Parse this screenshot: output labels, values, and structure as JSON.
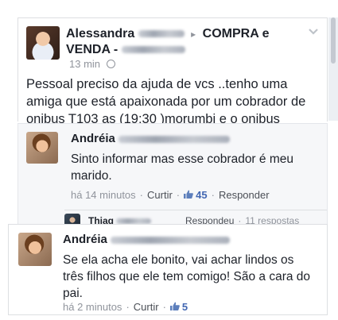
{
  "post": {
    "author_first": "Alessandra",
    "arrow": "▸",
    "group": "COMPRA e VENDA -",
    "time": "13 min",
    "text": "Pessoal preciso da ajuda de vcs ..tenho uma amiga que está apaixonada por um cobrador de onibus T103 as (19:30 )morumbi  e o onibus"
  },
  "comment1": {
    "author_first": "Andréia",
    "text": "Sinto informar mas esse cobrador é meu marido.",
    "time": "há 14 minutos",
    "curtir": "Curtir",
    "likes": "45",
    "responder": "Responder",
    "reply_preview_name": "Thiag",
    "reply_preview_action": "Respondeu",
    "reply_preview_count": "11 respostas"
  },
  "comment2": {
    "author_first": "Andréia",
    "text": "Se ela acha ele bonito, vai achar lindos os três filhos que ele tem comigo! São a cara do pai.",
    "time": "há 2 minutos",
    "curtir": "Curtir",
    "likes": "5"
  },
  "icons": {
    "globe": "globe-icon",
    "chevron": "chevron-down-icon",
    "like": "thumbs-up-icon"
  },
  "colors": {
    "link_blue": "#4267b2",
    "meta_gray": "#90949c",
    "text": "#1d2129",
    "comment_bg": "#f6f7f9"
  }
}
